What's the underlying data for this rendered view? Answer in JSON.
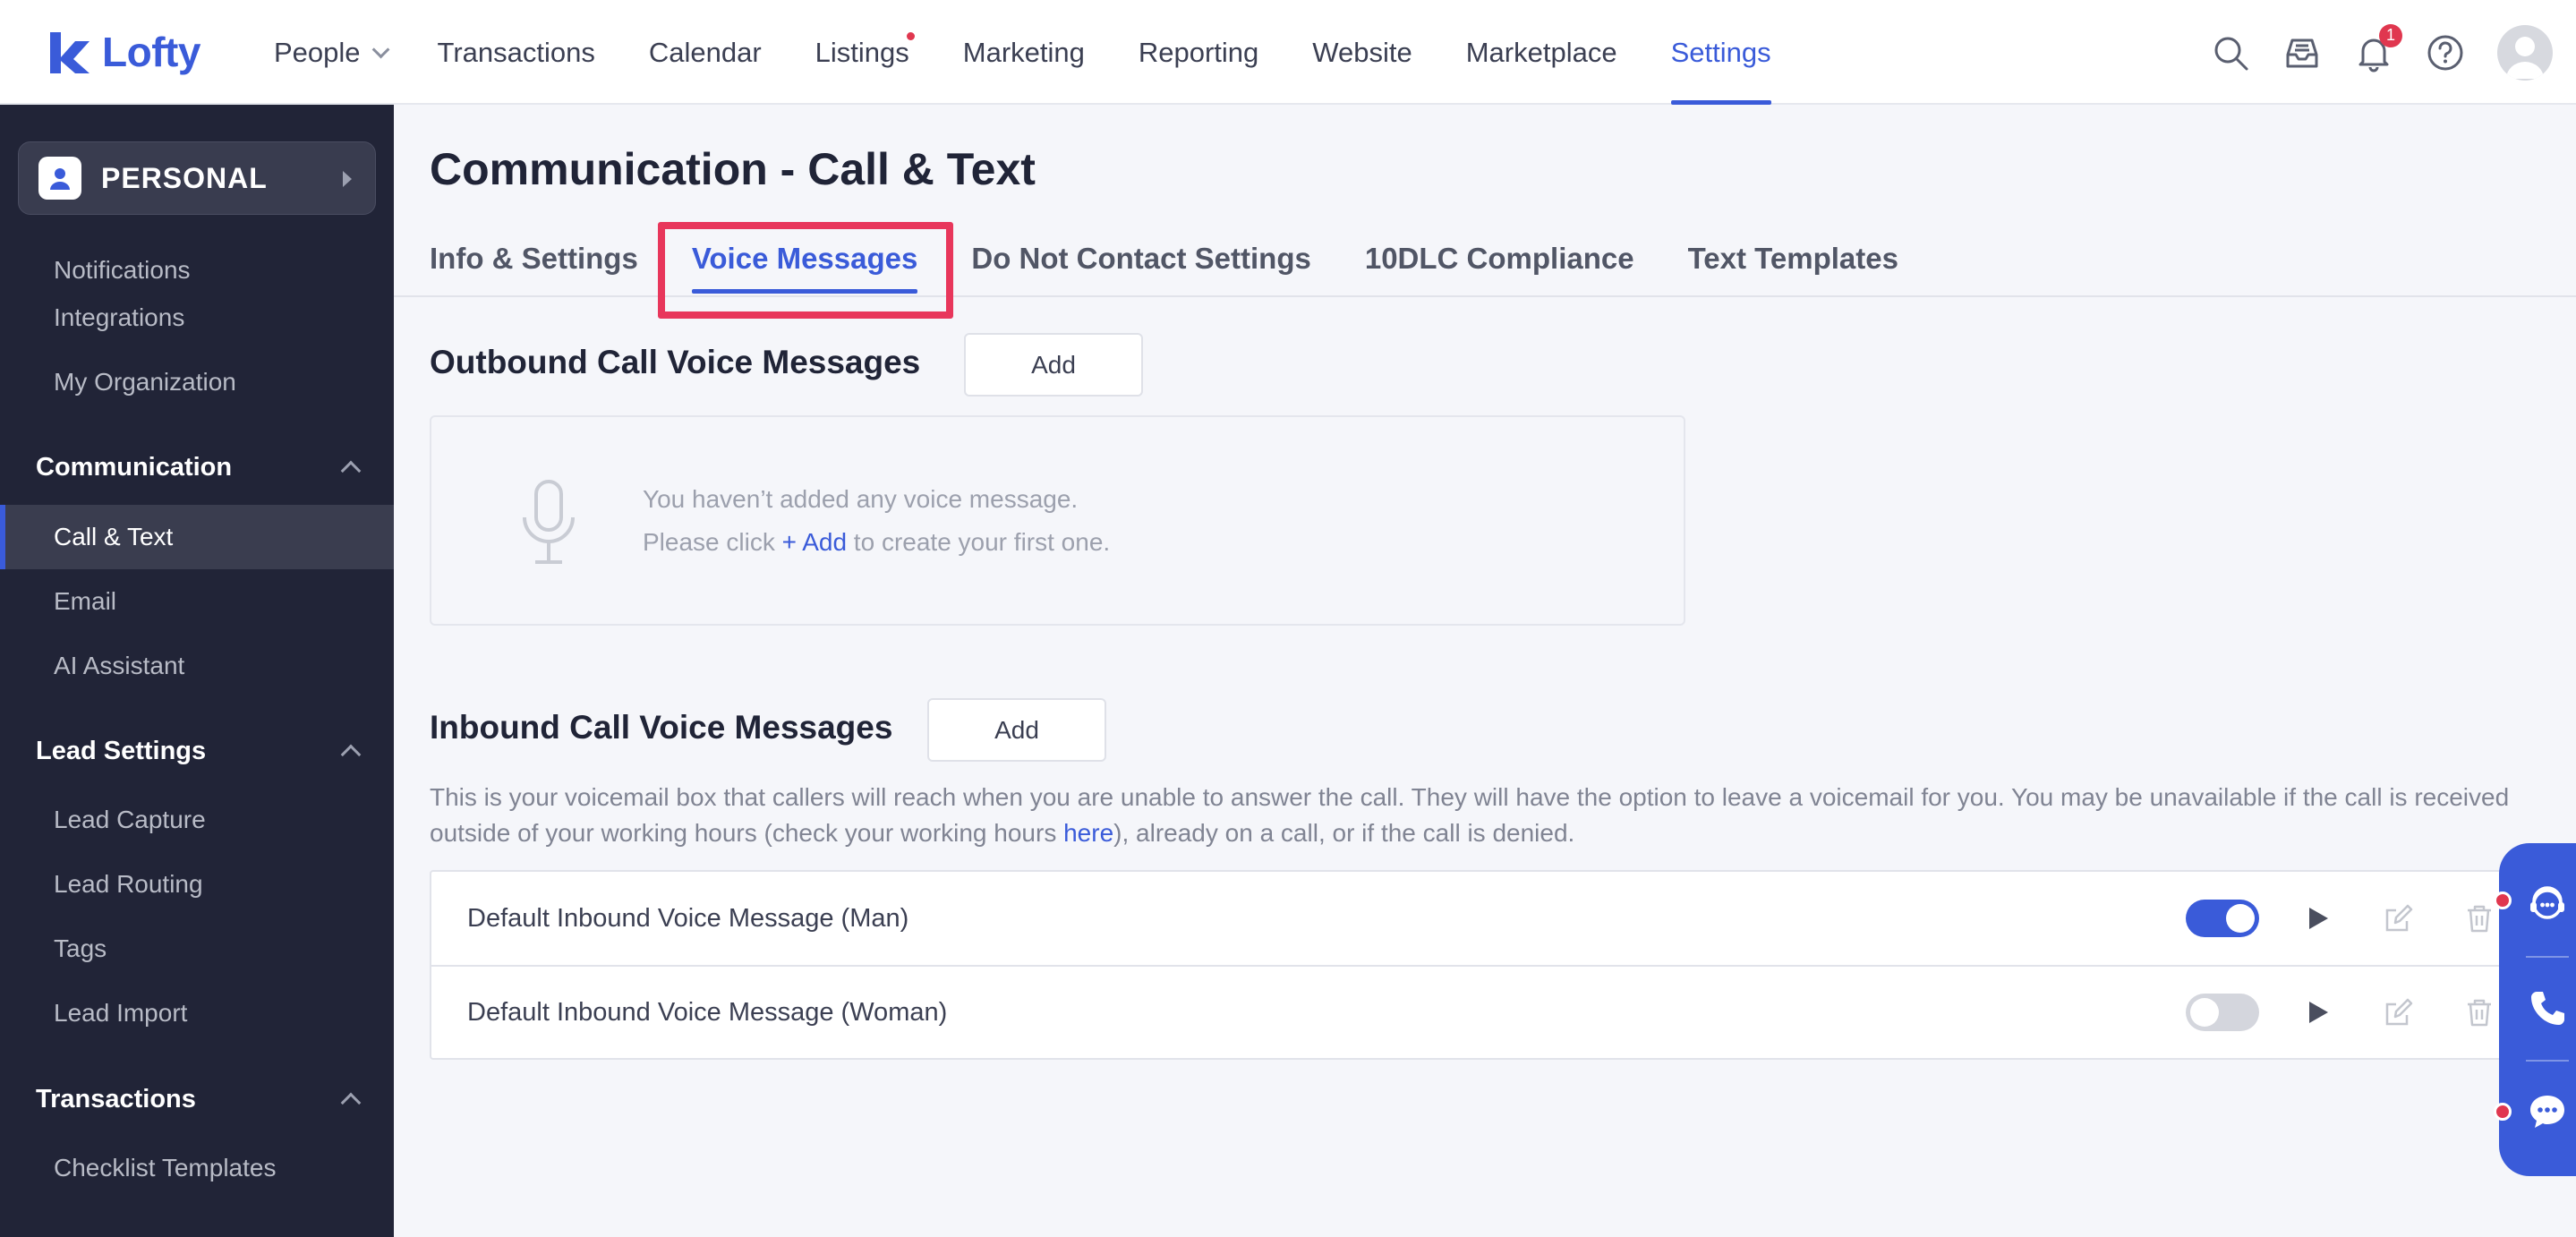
{
  "brand": {
    "name": "Lofty",
    "accent": "#3a5bd9"
  },
  "nav": {
    "items": [
      {
        "label": "People",
        "has_dropdown": true
      },
      {
        "label": "Transactions"
      },
      {
        "label": "Calendar"
      },
      {
        "label": "Listings",
        "has_dot": true
      },
      {
        "label": "Marketing"
      },
      {
        "label": "Reporting"
      },
      {
        "label": "Website"
      },
      {
        "label": "Marketplace"
      },
      {
        "label": "Settings",
        "active": true
      }
    ],
    "icons": [
      "search-icon",
      "inbox-icon",
      "bell-icon",
      "help-icon"
    ],
    "notification_count": "1"
  },
  "sidebar": {
    "workspace_label": "PERSONAL",
    "items": [
      {
        "label": "Notifications"
      },
      {
        "label": "Integrations"
      },
      {
        "label": "My Organization"
      }
    ],
    "groups": [
      {
        "title": "Communication",
        "items": [
          "Call & Text",
          "Email",
          "AI Assistant"
        ],
        "active": "Call & Text"
      },
      {
        "title": "Lead Settings",
        "items": [
          "Lead Capture",
          "Lead Routing",
          "Tags",
          "Lead Import"
        ]
      },
      {
        "title": "Transactions",
        "items": [
          "Checklist Templates"
        ]
      }
    ]
  },
  "page": {
    "title": "Communication - Call & Text",
    "tabs": [
      {
        "label": "Info & Settings"
      },
      {
        "label": "Voice Messages",
        "active": true
      },
      {
        "label": "Do Not Contact Settings"
      },
      {
        "label": "10DLC Compliance"
      },
      {
        "label": "Text Templates"
      }
    ]
  },
  "outbound": {
    "title": "Outbound Call Voice Messages",
    "add_label": "Add",
    "empty_line1": "You haven’t added any voice message.",
    "empty_line2_pre": "Please click ",
    "empty_link": "+ Add",
    "empty_line2_post": " to create your first one."
  },
  "inbound": {
    "title": "Inbound Call Voice Messages",
    "add_label": "Add",
    "description_pre": "This is your voicemail box that callers will reach when you are unable to answer the call. They will have the option to leave a voicemail for you. You may be unavailable if the call is received outside of your working hours (check your working hours ",
    "description_link": "here",
    "description_post": "), already on a call, or if the call is denied.",
    "messages": [
      {
        "name": "Default Inbound Voice Message (Man)",
        "enabled": true
      },
      {
        "name": "Default Inbound Voice Message (Woman)",
        "enabled": false
      }
    ]
  },
  "colors": {
    "sidebar_bg": "#212437",
    "highlight": "#e8365b",
    "badge": "#e0374f"
  }
}
